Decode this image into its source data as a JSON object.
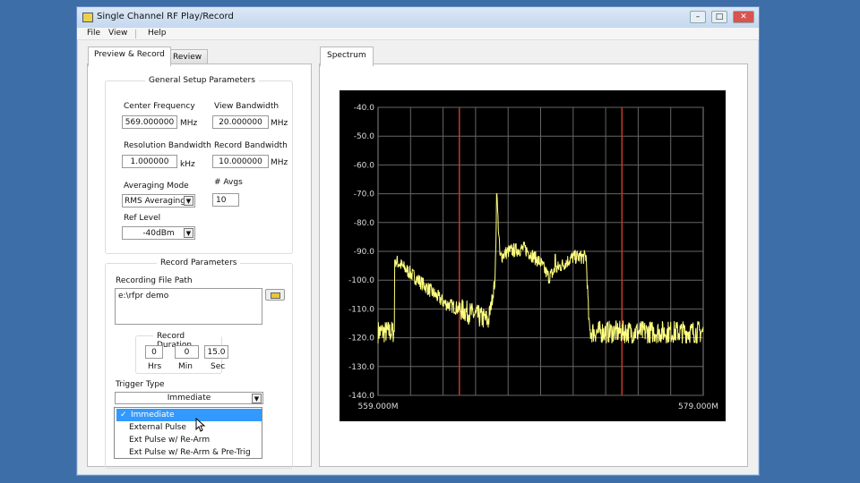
{
  "window": {
    "title": "Single Channel RF Play/Record",
    "icon": "labview-app-icon",
    "controls": [
      "minimize",
      "maximize",
      "close"
    ]
  },
  "menu": [
    "File",
    "View",
    "Help"
  ],
  "left_tabs": [
    {
      "label": "Preview & Record",
      "active": true
    },
    {
      "label": "Review",
      "active": false
    }
  ],
  "general": {
    "title": "General Setup Parameters",
    "center_frequency": {
      "label": "Center Frequency",
      "value": "569.000000",
      "unit": "MHz"
    },
    "view_bandwidth": {
      "label": "View Bandwidth",
      "value": "20.000000",
      "unit": "MHz"
    },
    "resolution_bandwidth": {
      "label": "Resolution Bandwidth",
      "value": "1.000000",
      "unit": "kHz"
    },
    "record_bandwidth": {
      "label": "Record Bandwidth",
      "value": "10.000000",
      "unit": "MHz"
    },
    "averaging_mode": {
      "label": "Averaging Mode",
      "value": "RMS Averaging"
    },
    "num_avgs": {
      "label": "# Avgs",
      "value": "10"
    },
    "ref_level": {
      "label": "Ref Level",
      "value": "-40dBm"
    }
  },
  "record": {
    "title": "Record Parameters",
    "file_path": {
      "label": "Recording File Path",
      "value": "e:\\rfpr demo",
      "icon": "folder-open-icon"
    },
    "duration": {
      "title": "Record Duration",
      "hrs": "0",
      "min": "0",
      "sec": "15.0",
      "hrs_label": "Hrs",
      "min_label": "Min",
      "sec_label": "Sec"
    },
    "trigger": {
      "label": "Trigger Type",
      "value": "Immediate",
      "options": [
        "Immediate",
        "External Pulse",
        "Ext Pulse w/ Re-Arm",
        "Ext Pulse w/ Re-Arm & Pre-Trig"
      ],
      "selected": 0
    }
  },
  "right_tabs": [
    {
      "label": "Spectrum",
      "active": true
    }
  ],
  "chart_data": {
    "type": "line",
    "xlim": [
      559,
      579
    ],
    "ylim": [
      -140,
      -40
    ],
    "x_tick_labels": [
      "559.000M",
      "579.000M"
    ],
    "y_ticks": [
      -40,
      -50,
      -60,
      -70,
      -80,
      -90,
      -100,
      -110,
      -120,
      -130,
      -140
    ],
    "y_tick_labels": [
      "-40.0",
      "-50.0",
      "-60.0",
      "-70.0",
      "-80.0",
      "-90.0",
      "-100.0",
      "-110.0",
      "-120.0",
      "-130.0",
      "-140.0"
    ],
    "grid": true,
    "colors": {
      "trace": "#ffff80",
      "markers": "#c0392b",
      "background": "#000000",
      "grid": "#888888"
    },
    "markers_x": [
      564,
      574
    ],
    "noise_floor": -118,
    "series": [
      {
        "x": [
          559,
          560,
          560.05,
          563.1,
          565.8,
          566.2,
          566.3,
          566.5,
          567,
          568,
          569,
          569.5,
          570,
          571,
          571.8,
          572,
          579
        ],
        "y": [
          -118,
          -118,
          -93,
          -108,
          -114,
          -100,
          -70,
          -92,
          -90,
          -89,
          -94,
          -99,
          -96,
          -92,
          -92,
          -118,
          -118
        ]
      }
    ]
  },
  "cursor": "arrow-pointer"
}
